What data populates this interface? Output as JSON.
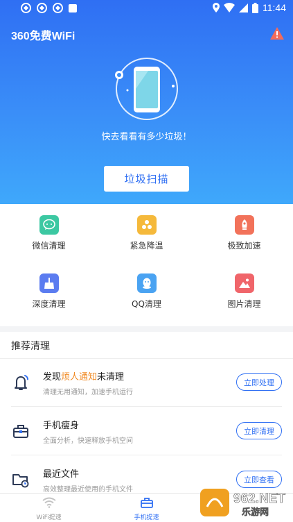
{
  "status_bar": {
    "time": "11:44"
  },
  "app": {
    "title": "360免费WiFi"
  },
  "hero": {
    "prompt": "快去看看有多少垃圾！",
    "scan_button": "垃圾扫描"
  },
  "tools": [
    {
      "label": "微信清理",
      "icon": "wechat-icon",
      "color": "#3cc8a2"
    },
    {
      "label": "紧急降温",
      "icon": "cooling-icon",
      "color": "#f5b93b"
    },
    {
      "label": "极致加速",
      "icon": "rocket-icon",
      "color": "#f2725a"
    },
    {
      "label": "深度清理",
      "icon": "broom-icon",
      "color": "#5b7cf0"
    },
    {
      "label": "QQ清理",
      "icon": "qq-icon",
      "color": "#4aa3f2"
    },
    {
      "label": "图片清理",
      "icon": "picture-icon",
      "color": "#f0656a"
    }
  ],
  "recommend": {
    "title": "推荐清理",
    "items": [
      {
        "pre": "发现",
        "highlight": "烦人通知",
        "post": "未清理",
        "sub": "清理无用通知，加速手机运行",
        "button": "立即处理",
        "icon": "bell-icon"
      },
      {
        "pre": "手机瘦身",
        "highlight": "",
        "post": "",
        "sub": "全面分析，快速释放手机空间",
        "button": "立即清理",
        "icon": "bag-icon"
      },
      {
        "pre": "最近文件",
        "highlight": "",
        "post": "",
        "sub": "高效整理最近使用的手机文件",
        "button": "立即查看",
        "icon": "folder-clock-icon"
      }
    ]
  },
  "bottom_nav": [
    {
      "label": "WiFi提速",
      "icon": "wifi-icon",
      "active": false
    },
    {
      "label": "手机提速",
      "icon": "toolbox-icon",
      "active": true
    },
    {
      "label": "",
      "icon": "",
      "active": false
    }
  ],
  "watermark": {
    "brand": "962.NET",
    "sub": "乐游网"
  },
  "colors": {
    "primary": "#2f6ff3",
    "highlight": "#f08a24",
    "warning": "#f26b5b"
  }
}
